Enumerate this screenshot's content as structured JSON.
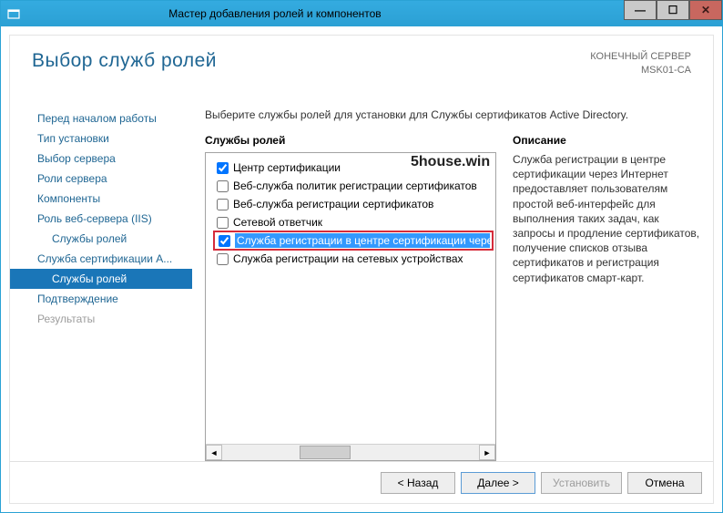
{
  "titlebar": {
    "title": "Мастер добавления ролей и компонентов"
  },
  "header": {
    "page_title": "Выбор служб ролей",
    "server_label": "КОНЕЧНЫЙ СЕРВЕР",
    "server_name": "MSK01-CA"
  },
  "sidebar": {
    "items": [
      {
        "label": "Перед началом работы",
        "active": false,
        "indent": false,
        "disabled": false
      },
      {
        "label": "Тип установки",
        "active": false,
        "indent": false,
        "disabled": false
      },
      {
        "label": "Выбор сервера",
        "active": false,
        "indent": false,
        "disabled": false
      },
      {
        "label": "Роли сервера",
        "active": false,
        "indent": false,
        "disabled": false
      },
      {
        "label": "Компоненты",
        "active": false,
        "indent": false,
        "disabled": false
      },
      {
        "label": "Роль веб-сервера (IIS)",
        "active": false,
        "indent": false,
        "disabled": false
      },
      {
        "label": "Службы ролей",
        "active": false,
        "indent": true,
        "disabled": false
      },
      {
        "label": "Служба сертификации A...",
        "active": false,
        "indent": false,
        "disabled": false
      },
      {
        "label": "Службы ролей",
        "active": true,
        "indent": true,
        "disabled": false
      },
      {
        "label": "Подтверждение",
        "active": false,
        "indent": false,
        "disabled": false
      },
      {
        "label": "Результаты",
        "active": false,
        "indent": false,
        "disabled": true
      }
    ]
  },
  "main": {
    "instruction": "Выберите службы ролей для установки для Службы сертификатов Active Directory.",
    "roles_header": "Службы ролей",
    "desc_header": "Описание",
    "roles": [
      {
        "label": "Центр сертификации",
        "checked": true,
        "highlighted": false
      },
      {
        "label": "Веб-служба политик регистрации сертификатов",
        "checked": false,
        "highlighted": false
      },
      {
        "label": "Веб-служба регистрации сертификатов",
        "checked": false,
        "highlighted": false
      },
      {
        "label": "Сетевой ответчик",
        "checked": false,
        "highlighted": false
      },
      {
        "label": "Служба регистрации в центре сертификации через Ин",
        "checked": true,
        "highlighted": true
      },
      {
        "label": "Служба регистрации на сетевых устройствах",
        "checked": false,
        "highlighted": false
      }
    ],
    "description": "Служба регистрации в центре сертификации через Интернет предоставляет пользователям простой веб-интерфейс для выполнения таких задач, как запросы и продление сертификатов, получение списков отзыва сертификатов и регистрация сертификатов смарт-карт."
  },
  "footer": {
    "back": "< Назад",
    "next": "Далее >",
    "install": "Установить",
    "cancel": "Отмена"
  },
  "watermark": "5house.win"
}
